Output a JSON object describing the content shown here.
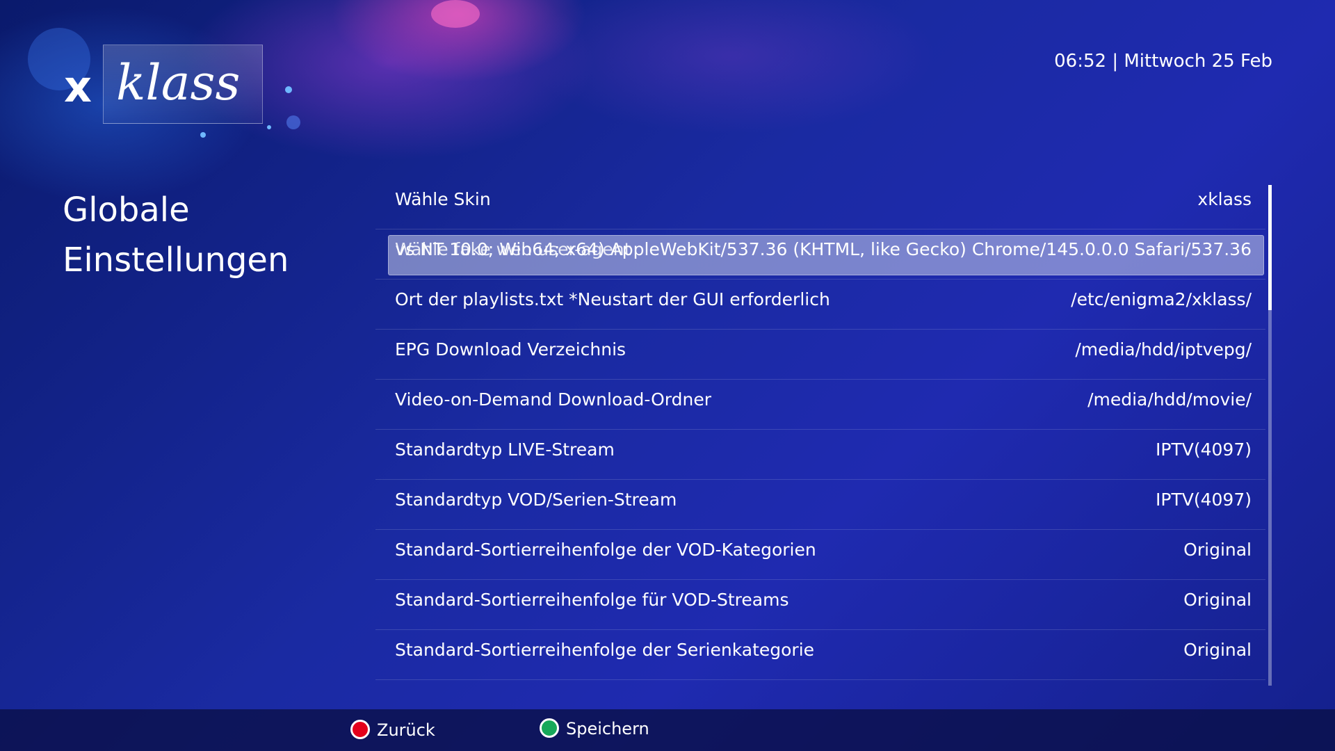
{
  "brand": {
    "logo_x": "x",
    "logo_text": "klass"
  },
  "header": {
    "clock": "06:52 | Mittwoch 25 Feb"
  },
  "page": {
    "title_line1": "Globale",
    "title_line2": "Einstellungen"
  },
  "settings": [
    {
      "label": "Wähle Skin",
      "value": "xklass"
    },
    {
      "label": "Wähle fake web user-agent",
      "value": "vs NT 10.0; Win64; x64) AppleWebKit/537.36 (KHTML, like Gecko) Chrome/145.0.0.0 Safari/537.36",
      "selected": true
    },
    {
      "label": "Ort der playlists.txt *Neustart der GUI erforderlich",
      "value": "/etc/enigma2/xklass/"
    },
    {
      "label": "EPG Download Verzeichnis",
      "value": "/media/hdd/iptvepg/"
    },
    {
      "label": "Video-on-Demand Download-Ordner",
      "value": "/media/hdd/movie/"
    },
    {
      "label": "Standardtyp LIVE-Stream",
      "value": "IPTV(4097)"
    },
    {
      "label": "Standardtyp VOD/Serien-Stream",
      "value": "IPTV(4097)"
    },
    {
      "label": "Standard-Sortierreihenfolge der VOD-Kategorien",
      "value": "Original"
    },
    {
      "label": "Standard-Sortierreihenfolge für VOD-Streams",
      "value": "Original"
    },
    {
      "label": "Standard-Sortierreihenfolge der Serienkategorie",
      "value": "Original"
    }
  ],
  "footer": {
    "back_label": "Zurück",
    "save_label": "Speichern"
  },
  "colors": {
    "red_button": "#e3001b",
    "green_button": "#17a85a",
    "background": "#1a2aa2"
  }
}
